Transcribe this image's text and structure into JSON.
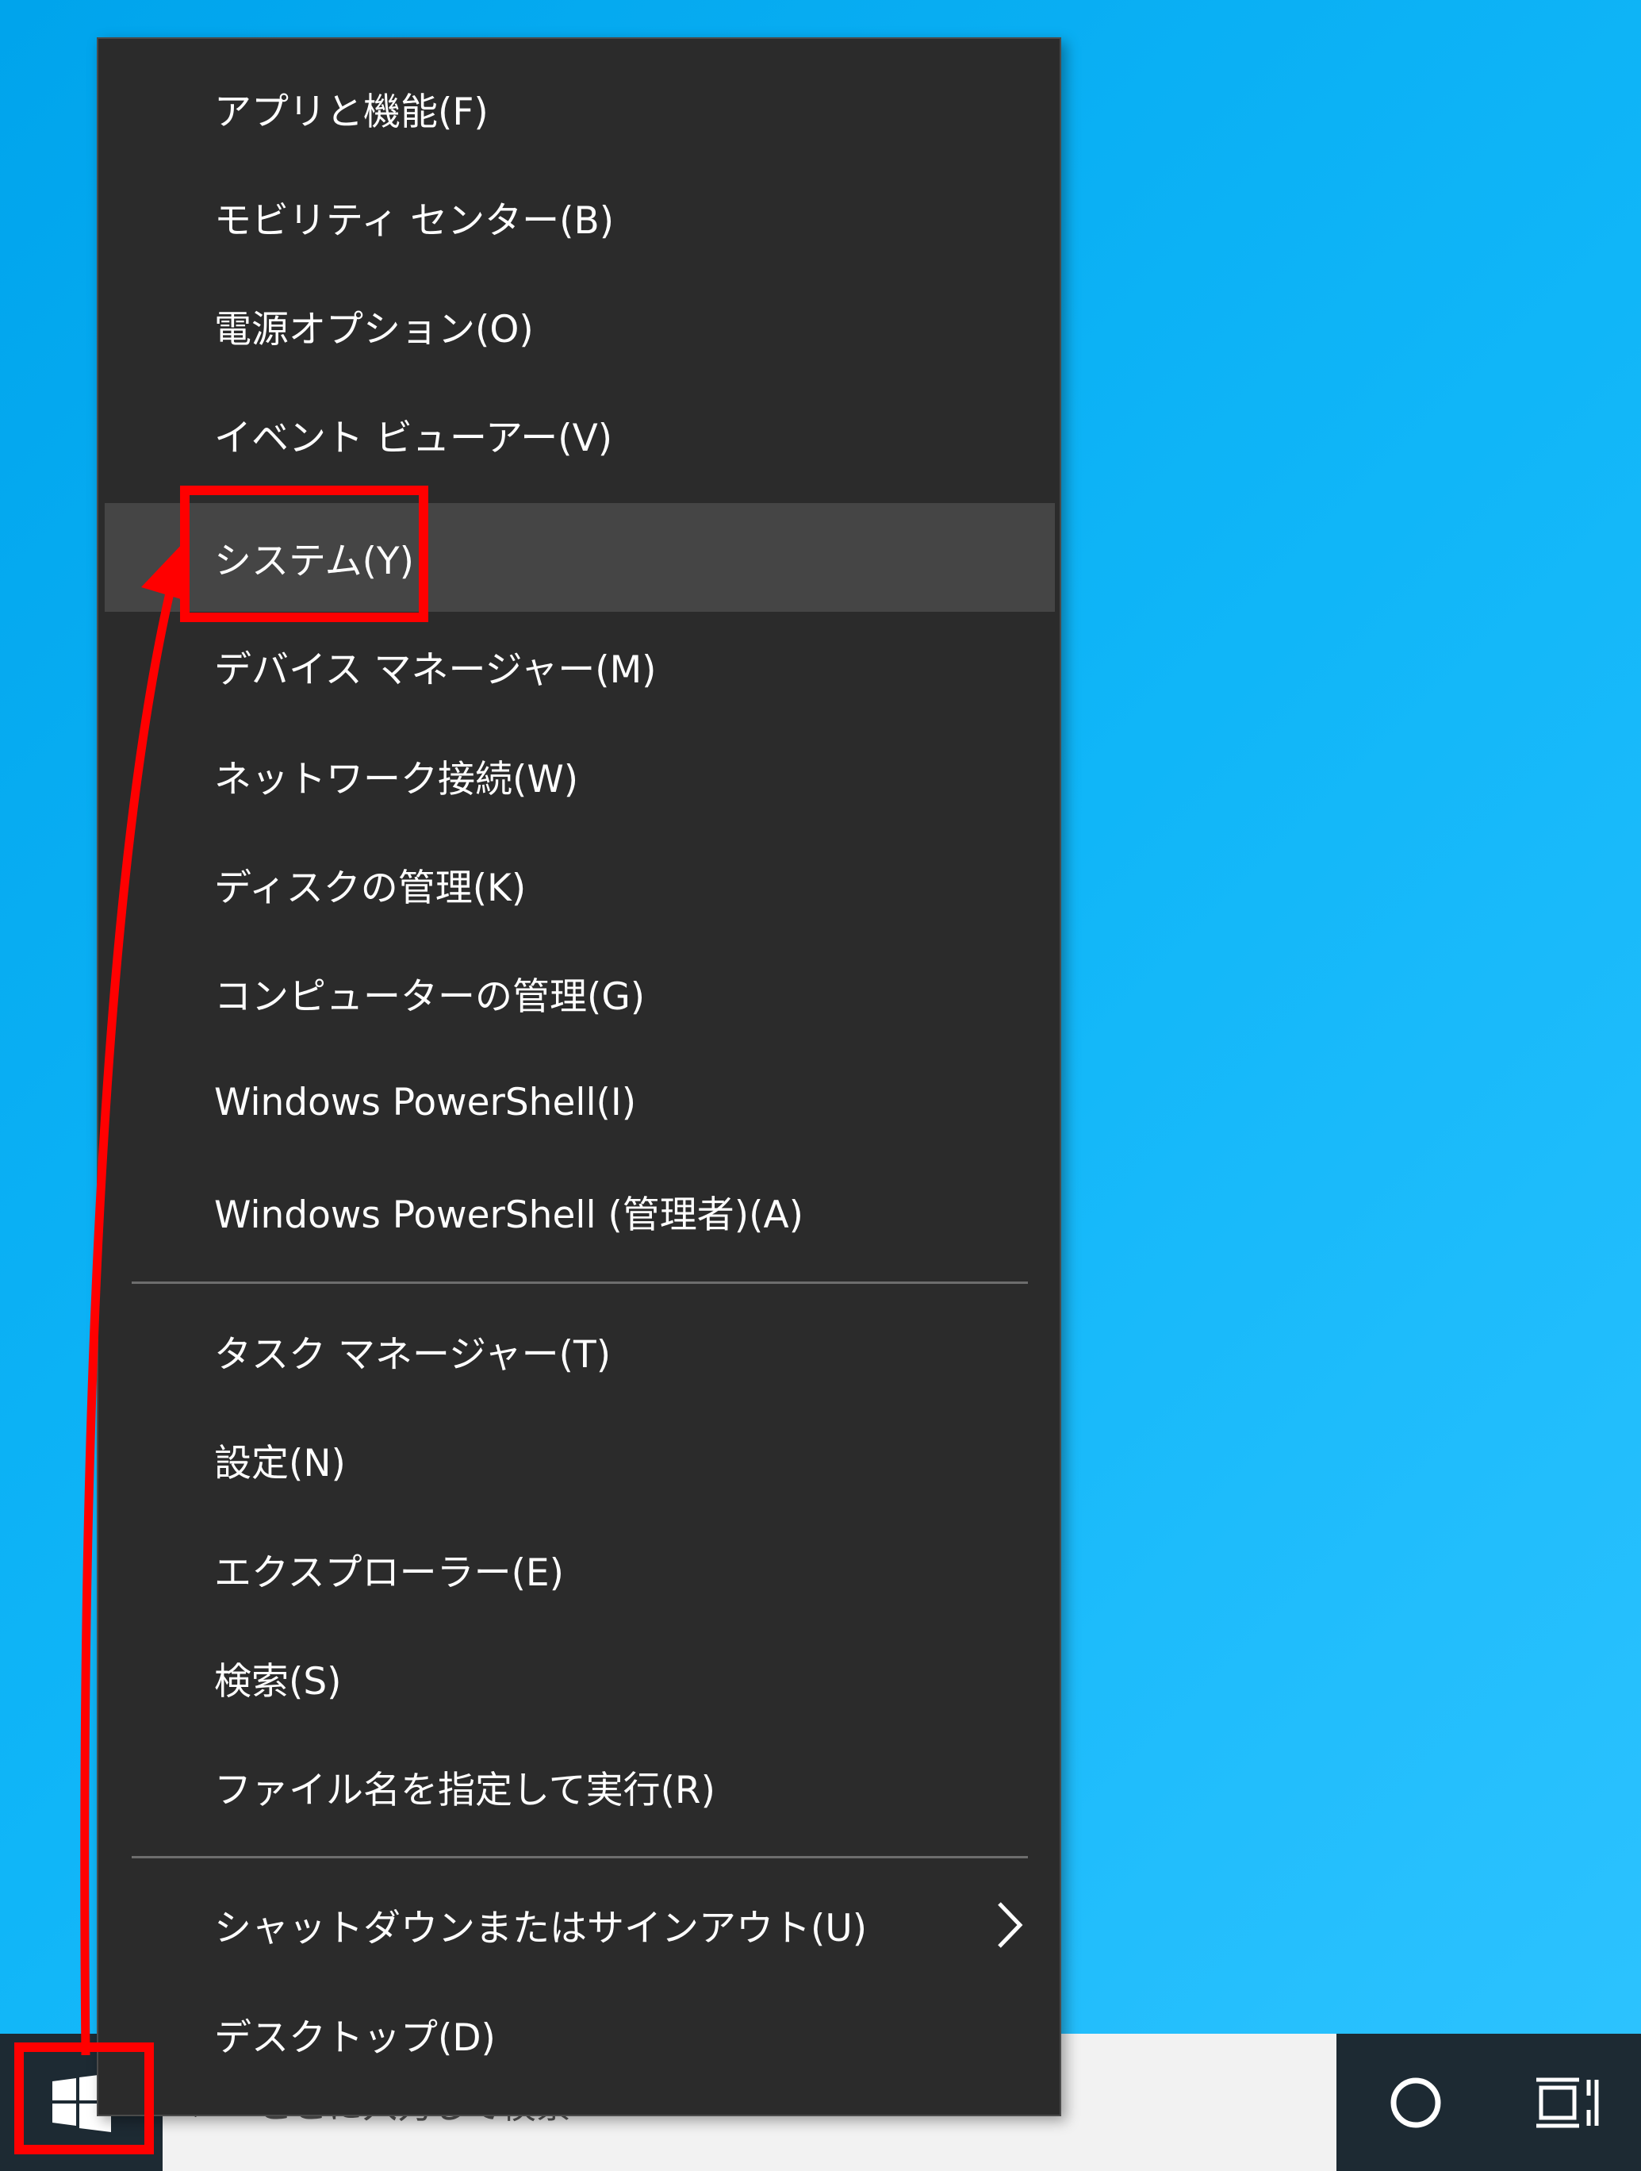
{
  "context_menu": {
    "items": [
      {
        "label": "アプリと機能(F)"
      },
      {
        "label": "モビリティ センター(B)"
      },
      {
        "label": "電源オプション(O)"
      },
      {
        "label": "イベント ビューアー(V)"
      },
      {
        "label": "システム(Y)"
      },
      {
        "label": "デバイス マネージャー(M)"
      },
      {
        "label": "ネットワーク接続(W)"
      },
      {
        "label": "ディスクの管理(K)"
      },
      {
        "label": "コンピューターの管理(G)"
      },
      {
        "label": "Windows PowerShell(I)"
      },
      {
        "label": "Windows PowerShell (管理者)(A)"
      },
      {
        "label": "タスク マネージャー(T)"
      },
      {
        "label": "設定(N)"
      },
      {
        "label": "エクスプローラー(E)"
      },
      {
        "label": "検索(S)"
      },
      {
        "label": "ファイル名を指定して実行(R)"
      },
      {
        "label": "シャットダウンまたはサインアウト(U)"
      },
      {
        "label": "デスクトップ(D)"
      }
    ],
    "highlighted_item": "システム(Y)"
  },
  "taskbar": {
    "search_placeholder": "ここに入力して検索"
  },
  "colors": {
    "annotation": "#ff0000",
    "menu_bg": "#2b2b2b",
    "menu_hover": "#454545",
    "desktop": "#0aaef5",
    "taskbar": "#1d2a33"
  },
  "icons": [
    "windows-logo-icon",
    "search-icon",
    "cortana-icon",
    "task-view-icon",
    "chevron-right-icon"
  ]
}
